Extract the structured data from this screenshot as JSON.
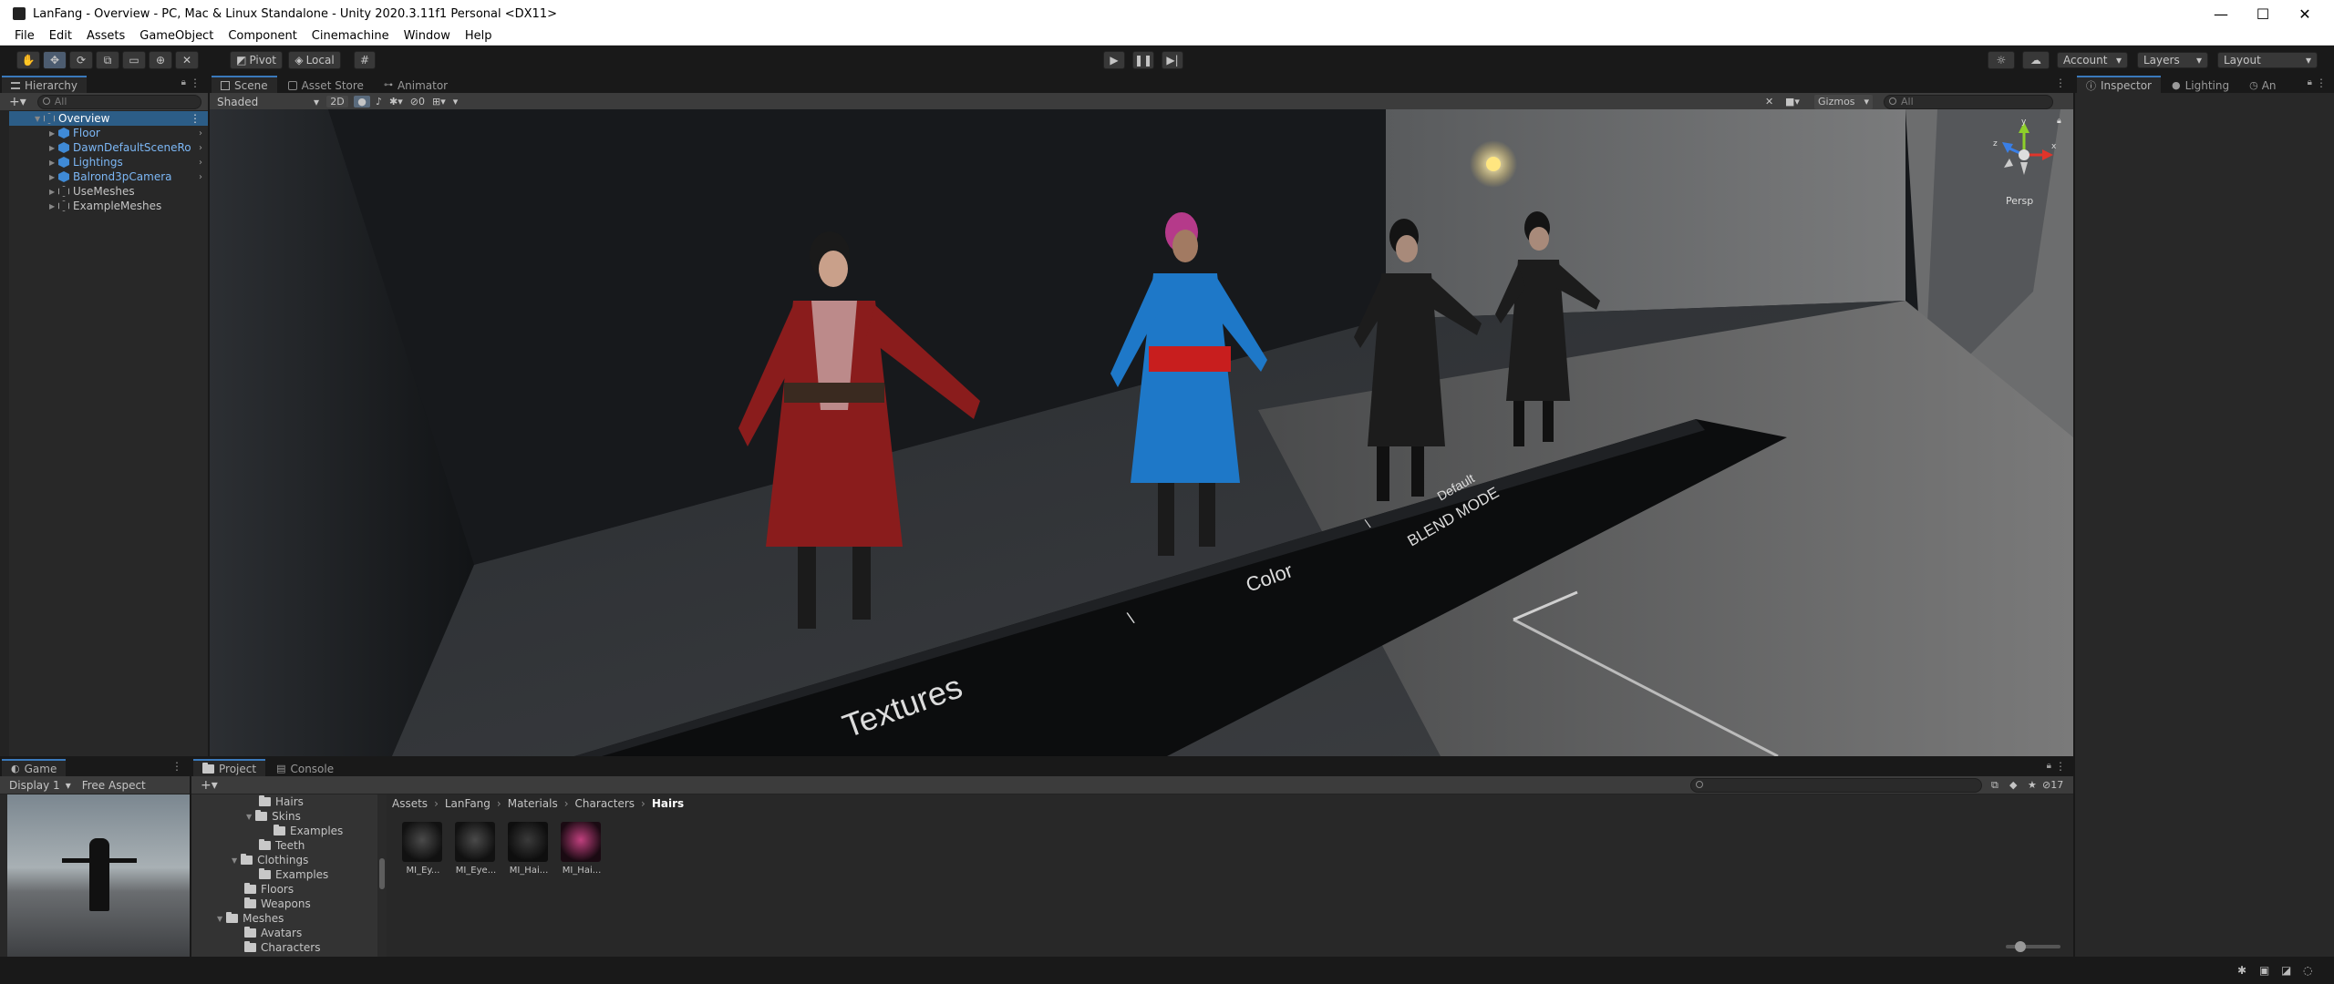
{
  "window": {
    "title": "LanFang - Overview - PC, Mac & Linux Standalone - Unity 2020.3.11f1 Personal <DX11>",
    "minimize": "—",
    "maximize": "☐",
    "close": "✕"
  },
  "menu": [
    "File",
    "Edit",
    "Assets",
    "GameObject",
    "Component",
    "Cinemachine",
    "Window",
    "Help"
  ],
  "toolbar": {
    "pivot": "Pivot",
    "local": "Local",
    "account": "Account",
    "layers": "Layers",
    "layout": "Layout"
  },
  "hierarchy": {
    "tab": "Hierarchy",
    "search_placeholder": "All",
    "scene": "Overview",
    "items": [
      {
        "label": "Floor",
        "prefab": true
      },
      {
        "label": "DawnDefaultSceneRo",
        "prefab": true
      },
      {
        "label": "Lightings",
        "prefab": true
      },
      {
        "label": "Balrond3pCamera",
        "prefab": true
      },
      {
        "label": "UseMeshes",
        "prefab": false
      },
      {
        "label": "ExampleMeshes",
        "prefab": false
      }
    ]
  },
  "scene": {
    "tabs": [
      "Scene",
      "Asset Store",
      "Animator"
    ],
    "shading": "Shaded",
    "mode2d": "2D",
    "hidden_count": "0",
    "gizmos": "Gizmos",
    "search_placeholder": "All",
    "persp": "Persp",
    "floor_labels": {
      "textures": "Textures",
      "color": "Color",
      "blend_mode": "BLEND MODE",
      "default": "Default",
      "slash": "\\"
    }
  },
  "right_panel": {
    "tabs": [
      "Inspector",
      "Lighting",
      "An"
    ]
  },
  "game": {
    "tab": "Game",
    "display": "Display 1",
    "aspect": "Free Aspect"
  },
  "project": {
    "tabs": [
      "Project",
      "Console"
    ],
    "tree": [
      {
        "label": "Hairs",
        "indent": 3
      },
      {
        "label": "Skins",
        "indent": 3,
        "open": true
      },
      {
        "label": "Examples",
        "indent": 4
      },
      {
        "label": "Teeth",
        "indent": 3
      },
      {
        "label": "Clothings",
        "indent": 2,
        "open": true
      },
      {
        "label": "Examples",
        "indent": 3
      },
      {
        "label": "Floors",
        "indent": 2
      },
      {
        "label": "Weapons",
        "indent": 2
      },
      {
        "label": "Meshes",
        "indent": 1,
        "open": true
      },
      {
        "label": "Avatars",
        "indent": 2
      },
      {
        "label": "Characters",
        "indent": 2
      }
    ],
    "breadcrumb": [
      "Assets",
      "LanFang",
      "Materials",
      "Characters",
      "Hairs"
    ],
    "assets": [
      "MI_Ey...",
      "MI_Eye...",
      "MI_Hai...",
      "MI_Hai..."
    ],
    "hidden_count": "17",
    "colors": {
      "asset_thumb_4": "#c0407e"
    }
  }
}
